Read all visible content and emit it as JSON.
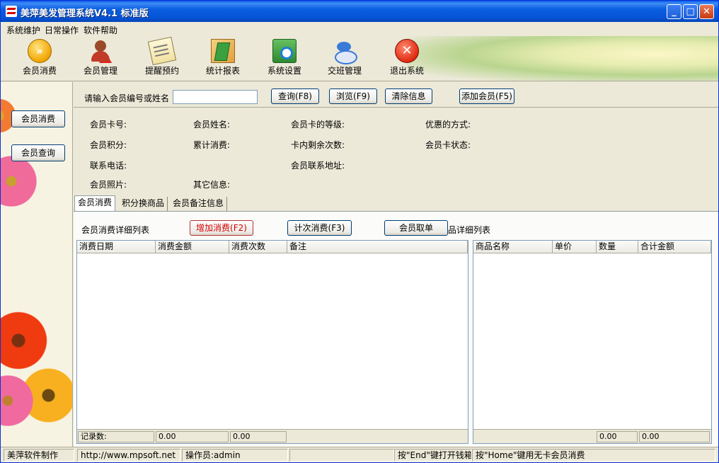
{
  "window": {
    "title": "美萍美发管理系统V4.1 标准版"
  },
  "menu": [
    "系统维护",
    "日常操作",
    "软件帮助"
  ],
  "toolbar": [
    {
      "label": "会员消费",
      "icon": "play-icon"
    },
    {
      "label": "会员管理",
      "icon": "member-warning-icon"
    },
    {
      "label": "提醒预约",
      "icon": "notepad-icon"
    },
    {
      "label": "统计报表",
      "icon": "report-icon"
    },
    {
      "label": "系统设置",
      "icon": "settings-icon"
    },
    {
      "label": "交班管理",
      "icon": "shift-handover-icon"
    },
    {
      "label": "退出系统",
      "icon": "exit-icon"
    }
  ],
  "sidebar": {
    "items": [
      "会员消费",
      "会员查询"
    ]
  },
  "search": {
    "label": "请输入会员编号或姓名",
    "value": "",
    "buttons": {
      "query": "查询(F8)",
      "browse": "浏览(F9)",
      "clear": "清除信息",
      "add": "添加会员(F5)"
    }
  },
  "info": {
    "card_no": "会员卡号:",
    "name": "会员姓名:",
    "level": "会员卡的等级:",
    "discount": "优惠的方式:",
    "points": "会员积分:",
    "total": "累计消费:",
    "remaining": "卡内剩余次数:",
    "status": "会员卡状态:",
    "phone": "联系电话:",
    "address": "会员联系地址:",
    "photo": "会员照片:",
    "other": "其它信息:"
  },
  "tabs": [
    "会员消费",
    "积分换商品",
    "会员备注信息"
  ],
  "consume": {
    "list_title": "会员消费详细列表",
    "add_button": "增加消费(F2)",
    "count_button": "计次消费(F3)",
    "order_button": "会员取单",
    "detail_title": "品详细列表",
    "left_columns": [
      "消费日期",
      "消费金额",
      "消费次数",
      "备注"
    ],
    "right_columns": [
      "商品名称",
      "单价",
      "数量",
      "合计金额"
    ],
    "left_footer": [
      "记录数:",
      "0.00",
      "0.00"
    ],
    "right_footer": [
      "0.00",
      "0.00"
    ]
  },
  "status": {
    "maker": "美萍软件制作",
    "url": "http://www.mpsoft.net",
    "operator": "操作员:admin",
    "empty": "",
    "end_hint": "按\"End\"键打开钱箱",
    "home_hint": "按\"Home\"键用无卡会员消费"
  }
}
